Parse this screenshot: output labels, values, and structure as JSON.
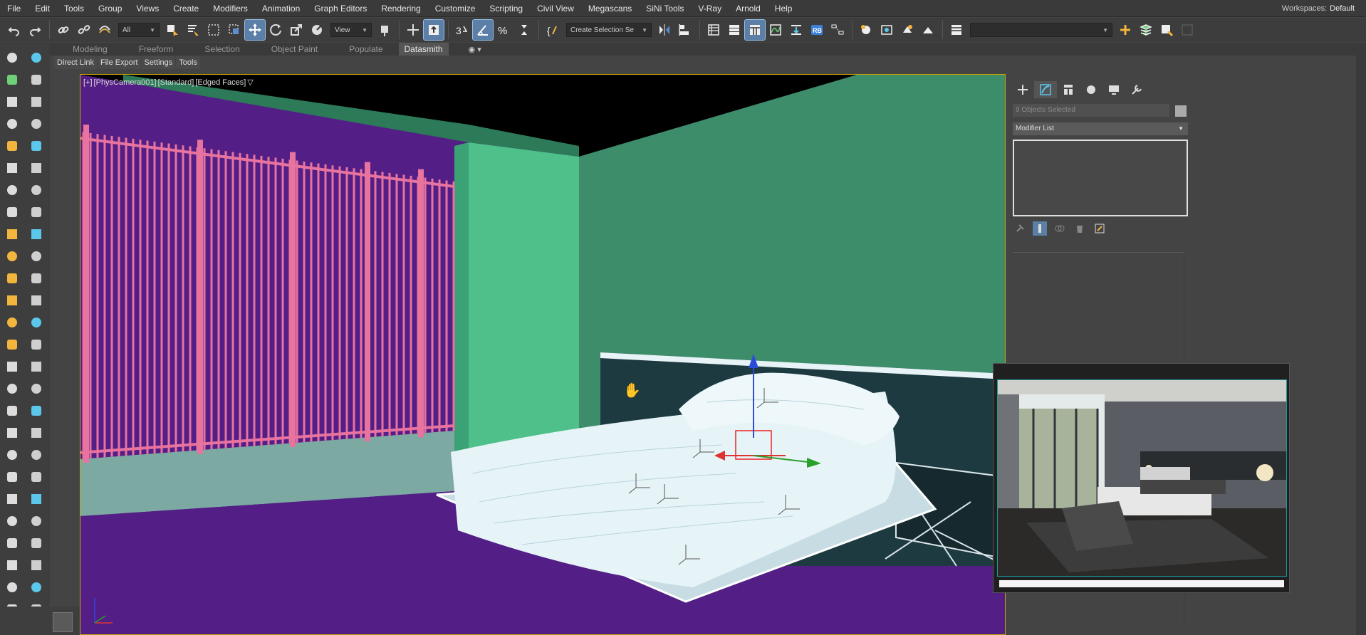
{
  "menu": [
    "File",
    "Edit",
    "Tools",
    "Group",
    "Views",
    "Create",
    "Modifiers",
    "Animation",
    "Graph Editors",
    "Rendering",
    "Customize",
    "Scripting",
    "Civil View",
    "Megascans",
    "SiNi Tools",
    "V-Ray",
    "Arnold",
    "Help"
  ],
  "workspace": {
    "label": "Workspaces:",
    "value": "Default"
  },
  "toolbar": {
    "filter_dropdown": "All",
    "refcoord_dropdown": "View",
    "selection_set": "Create Selection Se",
    "name_field": ""
  },
  "ribbon": {
    "tabs": [
      "Modeling",
      "Freeform",
      "Selection",
      "Object Paint",
      "Populate",
      "Datasmith"
    ],
    "selected": "Datasmith",
    "eye_icon": "eye-icon"
  },
  "subribbon": [
    "Direct Link",
    "File Export",
    "Settings",
    "Tools"
  ],
  "viewport": {
    "label_parts": [
      "[+]",
      "[PhysCamera001]",
      "[Standard]",
      "[Edged Faces]"
    ],
    "colors": {
      "floor": "#531f86",
      "wall_green": "#3d8c6a",
      "wall_light_green": "#4fc08a",
      "fence": "#e8739e",
      "bed": "#e6f4f8",
      "headboard": "#1d3a40",
      "sky": "#000000"
    }
  },
  "command_panel": {
    "objects_selected": "9 Objects Selected",
    "modifier_list": "Modifier List"
  },
  "icons": [
    "undo-icon",
    "redo-icon",
    "link-icon",
    "unlink-icon",
    "bind-space-warp-icon",
    "select-object-icon",
    "select-by-name-icon",
    "rectangular-selection-icon",
    "window-crossing-icon",
    "select-move-icon",
    "select-rotate-icon",
    "select-scale-icon",
    "placement-icon",
    "snap-3d-icon",
    "angle-snap-icon",
    "percent-snap-icon",
    "spinner-snap-icon",
    "mirror-icon",
    "align-icon",
    "scene-explorer-icon",
    "layer-explorer-icon",
    "ribbon-toggle-icon",
    "curve-editor-icon",
    "schematic-view-icon",
    "material-editor-icon",
    "render-setup-icon",
    "render-frame-icon",
    "render-icon",
    "hand-pan-icon"
  ]
}
